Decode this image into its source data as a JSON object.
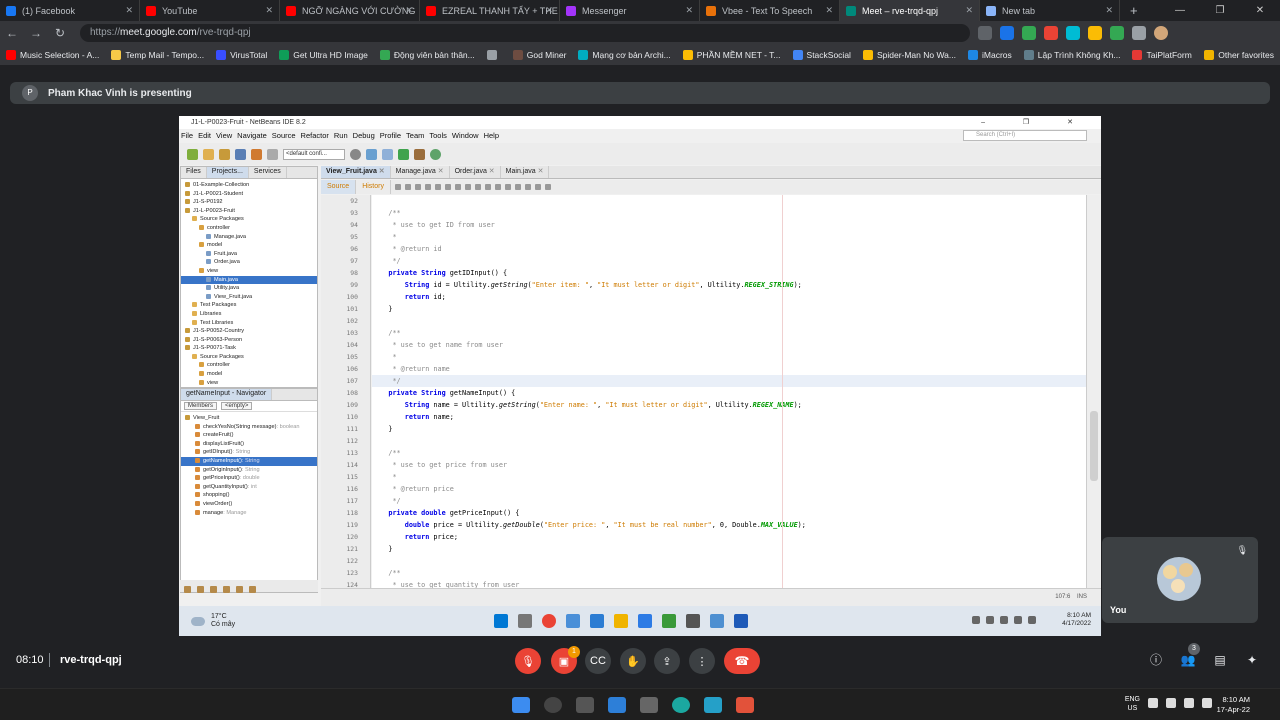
{
  "browser": {
    "tabs": [
      {
        "label": "(1) Facebook",
        "color": "#1877f2"
      },
      {
        "label": "YouTube",
        "color": "#ff0000"
      },
      {
        "label": "NGỠ NGÀNG VỚI CƯỜNG",
        "color": "#ff0000"
      },
      {
        "label": "EZREAL THANH TẨY + THE",
        "color": "#ff0000"
      },
      {
        "label": "Messenger",
        "color": "#a334fa"
      },
      {
        "label": "Vbee - Text To Speech",
        "color": "#e8710a"
      },
      {
        "label": "Meet – rve-trqd-qpj",
        "color": "#00897b"
      },
      {
        "label": "New tab",
        "color": "#8ab4f8"
      }
    ],
    "url_host": "meet.google.com",
    "url_path": "/rve-trqd-qpj",
    "url_prefix": "https://",
    "bookmarks": [
      {
        "label": "Music Selection - A...",
        "color": "#ff0000"
      },
      {
        "label": "Temp Mail - Tempo...",
        "color": "#f7c948"
      },
      {
        "label": "VirusTotal",
        "color": "#394eff"
      },
      {
        "label": "Get Ultra HD Image",
        "color": "#0f9d58"
      },
      {
        "label": "Động viên bản thân...",
        "color": "#34a853"
      },
      {
        "label": "",
        "color": "#9aa0a6"
      },
      {
        "label": "God Miner",
        "color": "#6d4c41"
      },
      {
        "label": "Mạng cơ bản Archi...",
        "color": "#00acc1"
      },
      {
        "label": "PHẦN MỀM NET - T...",
        "color": "#fbbc04"
      },
      {
        "label": "StackSocial",
        "color": "#4285f4"
      },
      {
        "label": "Spider-Man No Wa...",
        "color": "#fbbc04"
      },
      {
        "label": "iMacros",
        "color": "#1e88e5"
      },
      {
        "label": "Lập Trình Không Kh...",
        "color": "#607d8b"
      },
      {
        "label": "TaiPlatForm",
        "color": "#e53935"
      }
    ],
    "other_favorites": "Other favorites",
    "extension_colors": [
      "#5f6368",
      "#1a73e8",
      "#34a853",
      "#ea4335",
      "#00bcd4",
      "#fbbc04",
      "#34a853",
      "#9aa0a6"
    ]
  },
  "meet": {
    "presenter_initial": "P",
    "presenting_text": "Pham Khac Vinh is presenting",
    "time": "08:10",
    "meeting_code": "rve-trqd-qpj",
    "you_label": "You",
    "participants_count": "3",
    "notification_count": "1"
  },
  "netbeans": {
    "title": "J1-L-P0023-Fruit - NetBeans IDE 8.2",
    "window_controls": "– ❐ ✕",
    "menu": [
      "File",
      "Edit",
      "View",
      "Navigate",
      "Source",
      "Refactor",
      "Run",
      "Debug",
      "Profile",
      "Team",
      "Tools",
      "Window",
      "Help"
    ],
    "search_placeholder": "Search (Ctrl+I)",
    "config": "<default confi...",
    "panel_tabs": [
      "Files",
      "Projects...",
      "Services"
    ],
    "tree": [
      {
        "label": "01-Example-Collection",
        "indent": 0,
        "color": "#c79a3a"
      },
      {
        "label": "J1-L-P0021-Student",
        "indent": 0,
        "color": "#c79a3a"
      },
      {
        "label": "J1-S-P0192",
        "indent": 0,
        "color": "#c79a3a"
      },
      {
        "label": "J1-L-P0023-Fruit",
        "indent": 0,
        "color": "#c79a3a"
      },
      {
        "label": "Source Packages",
        "indent": 1,
        "color": "#e0b050"
      },
      {
        "label": "controller",
        "indent": 2,
        "color": "#d8a040"
      },
      {
        "label": "Manage.java",
        "indent": 3,
        "color": "#7a9cc6"
      },
      {
        "label": "model",
        "indent": 2,
        "color": "#d8a040"
      },
      {
        "label": "Fruit.java",
        "indent": 3,
        "color": "#7a9cc6"
      },
      {
        "label": "Order.java",
        "indent": 3,
        "color": "#7a9cc6"
      },
      {
        "label": "view",
        "indent": 2,
        "color": "#d8a040"
      },
      {
        "label": "Main.java",
        "indent": 3,
        "color": "#7a9cc6",
        "selected": true
      },
      {
        "label": "Utility.java",
        "indent": 3,
        "color": "#7a9cc6"
      },
      {
        "label": "View_Fruit.java",
        "indent": 3,
        "color": "#7a9cc6"
      },
      {
        "label": "Test Packages",
        "indent": 1,
        "color": "#e0b050"
      },
      {
        "label": "Libraries",
        "indent": 1,
        "color": "#e0b050"
      },
      {
        "label": "Test Libraries",
        "indent": 1,
        "color": "#e0b050"
      },
      {
        "label": "J1-S-P0052-Country",
        "indent": 0,
        "color": "#c79a3a"
      },
      {
        "label": "J1-S-P0063-Person",
        "indent": 0,
        "color": "#c79a3a"
      },
      {
        "label": "J1-S-P0071-Task",
        "indent": 0,
        "color": "#c79a3a"
      },
      {
        "label": "Source Packages",
        "indent": 1,
        "color": "#e0b050"
      },
      {
        "label": "controller",
        "indent": 2,
        "color": "#d8a040"
      },
      {
        "label": "model",
        "indent": 2,
        "color": "#d8a040"
      },
      {
        "label": "view",
        "indent": 2,
        "color": "#d8a040"
      }
    ],
    "navigator_title": "getNameInput - Navigator",
    "navigator_filter": "Members",
    "navigator_empty": "<empty>",
    "navigator_items": [
      {
        "label": "View_Fruit",
        "type": "",
        "indent": 0
      },
      {
        "label": "checkYesNo(String message)",
        "type": ": boolean",
        "indent": 1
      },
      {
        "label": "createFruit()",
        "type": "",
        "indent": 1
      },
      {
        "label": "displayListFruit()",
        "type": "",
        "indent": 1
      },
      {
        "label": "getIDInput()",
        "type": ": String",
        "indent": 1
      },
      {
        "label": "getNameInput()",
        "type": ": String",
        "indent": 1,
        "selected": true
      },
      {
        "label": "getOriginInput()",
        "type": ": String",
        "indent": 1
      },
      {
        "label": "getPriceInput()",
        "type": ": double",
        "indent": 1
      },
      {
        "label": "getQuantityInput()",
        "type": ": int",
        "indent": 1
      },
      {
        "label": "shopping()",
        "type": "",
        "indent": 1
      },
      {
        "label": "viewOrder()",
        "type": "",
        "indent": 1
      },
      {
        "label": "manage",
        "type": ": Manage",
        "indent": 1
      }
    ],
    "editor_tabs": [
      "View_Fruit.java",
      "Manage.java",
      "Order.java",
      "Main.java"
    ],
    "source_label": "Source",
    "history_label": "History",
    "status_pos": "107:6",
    "status_mode": "INS",
    "code": [
      {
        "n": "92",
        "t": ""
      },
      {
        "n": "93",
        "t": "    /**",
        "c": "cm"
      },
      {
        "n": "94",
        "t": "     * use to get ID from user",
        "c": "cm"
      },
      {
        "n": "95",
        "t": "     *",
        "c": "cm"
      },
      {
        "n": "96",
        "t": "     * @return id",
        "c": "cm"
      },
      {
        "n": "97",
        "t": "     */",
        "c": "cm"
      },
      {
        "n": "98",
        "t": "    private String getIDInput() {",
        "c": "sig"
      },
      {
        "n": "99",
        "t": "        String id = Ultility.getString(\"Enter item: \", \"It must letter or digit\", Ultility.REGEX_STRING);",
        "c": "body"
      },
      {
        "n": "100",
        "t": "        return id;",
        "c": "ret"
      },
      {
        "n": "101",
        "t": "    }"
      },
      {
        "n": "102",
        "t": ""
      },
      {
        "n": "103",
        "t": "    /**",
        "c": "cm"
      },
      {
        "n": "104",
        "t": "     * use to get name from user",
        "c": "cm"
      },
      {
        "n": "105",
        "t": "     *",
        "c": "cm"
      },
      {
        "n": "106",
        "t": "     * @return name",
        "c": "cm"
      },
      {
        "n": "107",
        "t": "     */",
        "c": "cm",
        "hl": true
      },
      {
        "n": "108",
        "t": "    private String getNameInput() {",
        "c": "sig"
      },
      {
        "n": "109",
        "t": "        String name = Ultility.getString(\"Enter name: \", \"It must letter or digit\", Ultility.REGEX_NAME);",
        "c": "body"
      },
      {
        "n": "110",
        "t": "        return name;",
        "c": "ret"
      },
      {
        "n": "111",
        "t": "    }"
      },
      {
        "n": "112",
        "t": ""
      },
      {
        "n": "113",
        "t": "    /**",
        "c": "cm"
      },
      {
        "n": "114",
        "t": "     * use to get price from user",
        "c": "cm"
      },
      {
        "n": "115",
        "t": "     *",
        "c": "cm"
      },
      {
        "n": "116",
        "t": "     * @return price",
        "c": "cm"
      },
      {
        "n": "117",
        "t": "     */",
        "c": "cm"
      },
      {
        "n": "118",
        "t": "    private double getPriceInput() {",
        "c": "sig"
      },
      {
        "n": "119",
        "t": "        double price = Ultility.getDouble(\"Enter price: \", \"It must be real number\", 0, Double.MAX_VALUE);",
        "c": "body"
      },
      {
        "n": "120",
        "t": "        return price;",
        "c": "ret"
      },
      {
        "n": "121",
        "t": "    }"
      },
      {
        "n": "122",
        "t": ""
      },
      {
        "n": "123",
        "t": "    /**",
        "c": "cm"
      },
      {
        "n": "124",
        "t": "     * use to get quantity from user",
        "c": "cm"
      }
    ]
  },
  "shared_taskbar": {
    "temp": "17°C",
    "weather": "Có mây",
    "time": "8:10 AM",
    "date": "4/17/2022"
  },
  "taskbar": {
    "lang1": "ENG",
    "lang2": "US",
    "time": "8:10 AM",
    "date": "17-Apr-22"
  }
}
